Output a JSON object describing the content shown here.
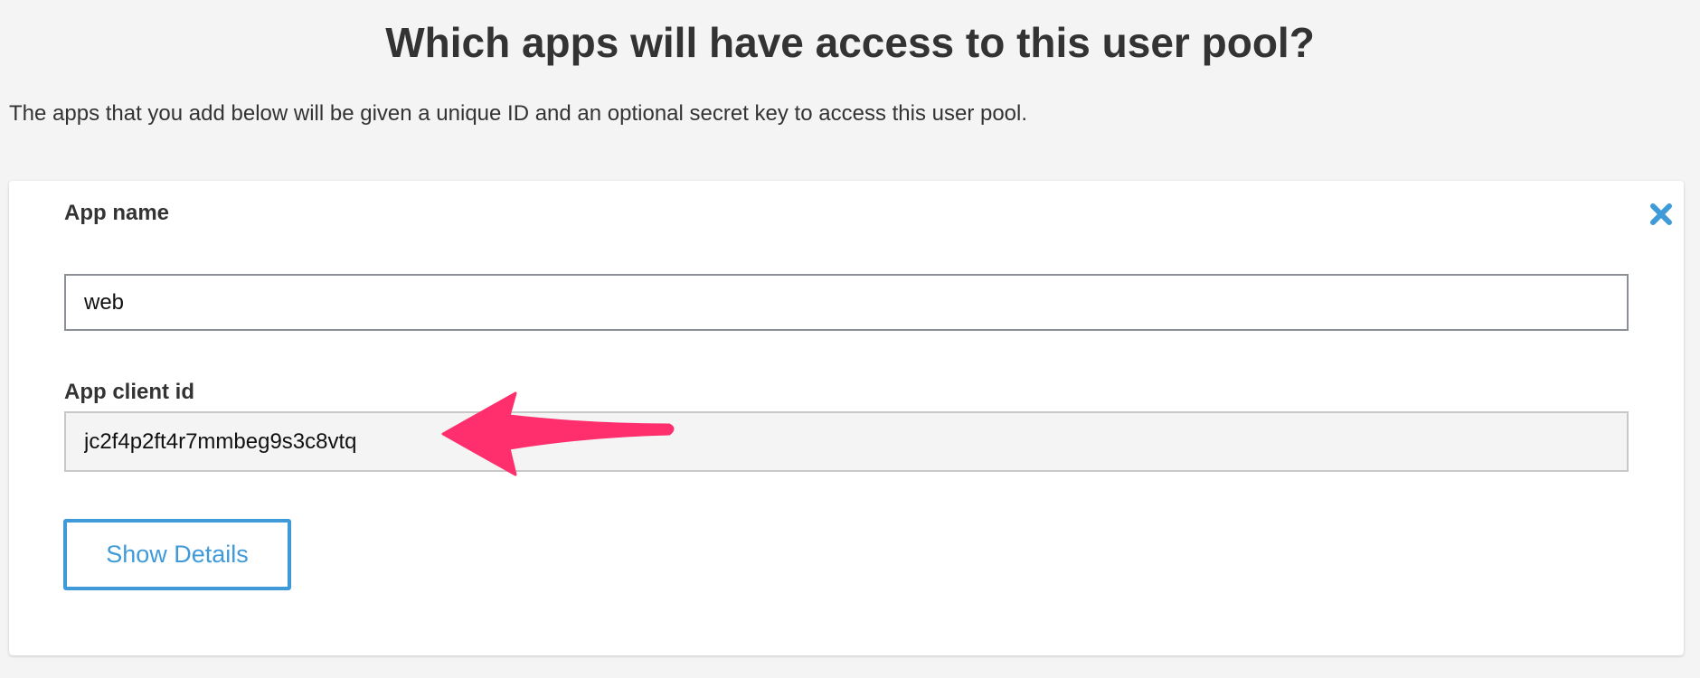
{
  "page": {
    "title": "Which apps will have access to this user pool?",
    "subtitle": "The apps that you add below will be given a unique ID and an optional secret key to access this user pool."
  },
  "app_card": {
    "close_icon": "close-x-icon",
    "app_name_label": "App name",
    "app_name_value": "web",
    "client_id_label": "App client id",
    "client_id_value": "jc2f4p2ft4r7mmbeg9s3c8vtq",
    "show_details_label": "Show Details"
  },
  "annotation": {
    "icon": "arrow-left-icon",
    "color": "#ff2e6c"
  },
  "colors": {
    "accent": "#3f9ad9",
    "background": "#f3f4f3"
  }
}
